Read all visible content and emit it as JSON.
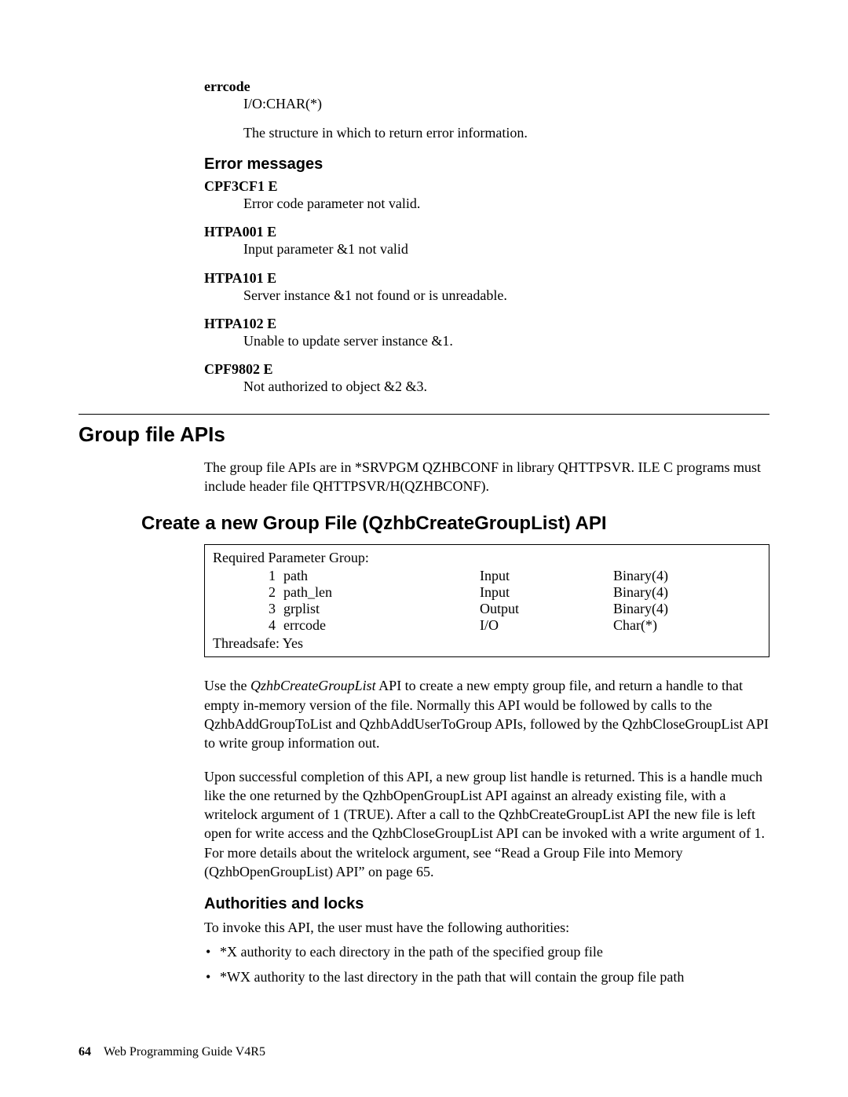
{
  "errcode": {
    "term": "errcode",
    "line1": "I/O:CHAR(*)",
    "line2": "The structure in which to return error information."
  },
  "error_messages": {
    "heading": "Error messages",
    "items": [
      {
        "code": "CPF3CF1 E",
        "desc": "Error code parameter not valid."
      },
      {
        "code": "HTPA001 E",
        "desc": "Input parameter &1 not valid"
      },
      {
        "code": "HTPA101 E",
        "desc": "Server instance &1 not found or is unreadable."
      },
      {
        "code": "HTPA102 E",
        "desc": "Unable to update server instance &1."
      },
      {
        "code": "CPF9802 E",
        "desc": "Not authorized to object &2 &3."
      }
    ]
  },
  "group_file": {
    "heading": "Group file APIs",
    "intro": "The group file APIs are in *SRVPGM QZHBCONF in library QHTTPSVR. ILE C programs must include header file QHTTPSVR/H(QZHBCONF)."
  },
  "create_api": {
    "heading": "Create a new Group File (QzhbCreateGroupList) API",
    "table": {
      "title": "Required Parameter Group:",
      "rows": [
        {
          "num": "1",
          "name": "path",
          "io": "Input",
          "type": "Binary(4)"
        },
        {
          "num": "2",
          "name": "path_len",
          "io": "Input",
          "type": "Binary(4)"
        },
        {
          "num": "3",
          "name": "grplist",
          "io": "Output",
          "type": "Binary(4)"
        },
        {
          "num": "4",
          "name": "errcode",
          "io": "I/O",
          "type": "Char(*)"
        }
      ],
      "threadsafe": "Threadsafe: Yes"
    },
    "para1_pre": "Use the ",
    "para1_api": "QzhbCreateGroupList",
    "para1_post": " API to create a new empty group file, and return a handle to that empty in-memory version of the file. Normally this API would be followed by calls to the QzhbAddGroupToList and QzhbAddUserToGroup APIs, followed by the QzhbCloseGroupList API to write group information out.",
    "para2": "Upon successful completion of this API, a new group list handle is returned. This is a handle much like the one returned by the QzhbOpenGroupList API against an already existing file, with a writelock argument of 1 (TRUE). After a call to the QzhbCreateGroupList API the new file is left open for write access and the QzhbCloseGroupList API can be invoked with a write argument of 1. For more details about the writelock argument, see “Read a Group File into Memory (QzhbOpenGroupList) API” on page 65."
  },
  "auth": {
    "heading": "Authorities and locks",
    "intro": "To invoke this API, the user must have the following authorities:",
    "bullets": [
      "*X authority to each directory in the path of the specified group file",
      "*WX authority to the last directory in the path that will contain the group file path"
    ]
  },
  "footer": {
    "pageno": "64",
    "title": "Web Programming Guide V4R5"
  }
}
